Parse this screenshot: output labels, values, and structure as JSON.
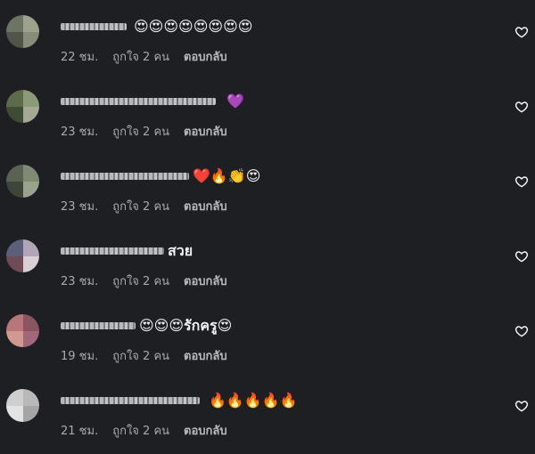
{
  "comments": [
    {
      "avatar": [
        "#6c7466",
        "#9da28f",
        "#4f5548",
        "#878c7b"
      ],
      "text": "😍😍😍😍😍😍😍😍",
      "time": "22 ชม.",
      "likes": "ถูกใจ 2 คน",
      "reply": "ตอบกลับ"
    },
    {
      "avatar": [
        "#5c6b4a",
        "#8c9a77",
        "#3f4b36",
        "#a6a896"
      ],
      "text": "💜",
      "time": "23 ชม.",
      "likes": "ถูกใจ 2 คน",
      "reply": "ตอบกลับ"
    },
    {
      "avatar": [
        "#5a6353",
        "#7f8a74",
        "#3e4639",
        "#9aa18e"
      ],
      "text": "❤️🔥👏😍",
      "time": "23 ชม.",
      "likes": "ถูกใจ 2 คน",
      "reply": "ตอบกลับ"
    },
    {
      "avatar": [
        "#5c5f7a",
        "#b0a6b8",
        "#6e4b56",
        "#d8d0d4"
      ],
      "text": "สวย",
      "time": "23 ชม.",
      "likes": "ถูกใจ 2 คน",
      "reply": "ตอบกลับ"
    },
    {
      "avatar": [
        "#b8757a",
        "#8a5560",
        "#d29892",
        "#a0687a"
      ],
      "text": "😍😍😍รักครู😍",
      "time": "19 ชม.",
      "likes": "ถูกใจ 2 คน",
      "reply": "ตอบกลับ"
    },
    {
      "avatar": [
        "#cfcfcf",
        "#b9b9b9",
        "#e3e3e3",
        "#a5a5a5"
      ],
      "text": "🔥🔥🔥🔥🔥",
      "time": "21 ชม.",
      "likes": "ถูกใจ 2 คน",
      "reply": "ตอบกลับ"
    }
  ]
}
